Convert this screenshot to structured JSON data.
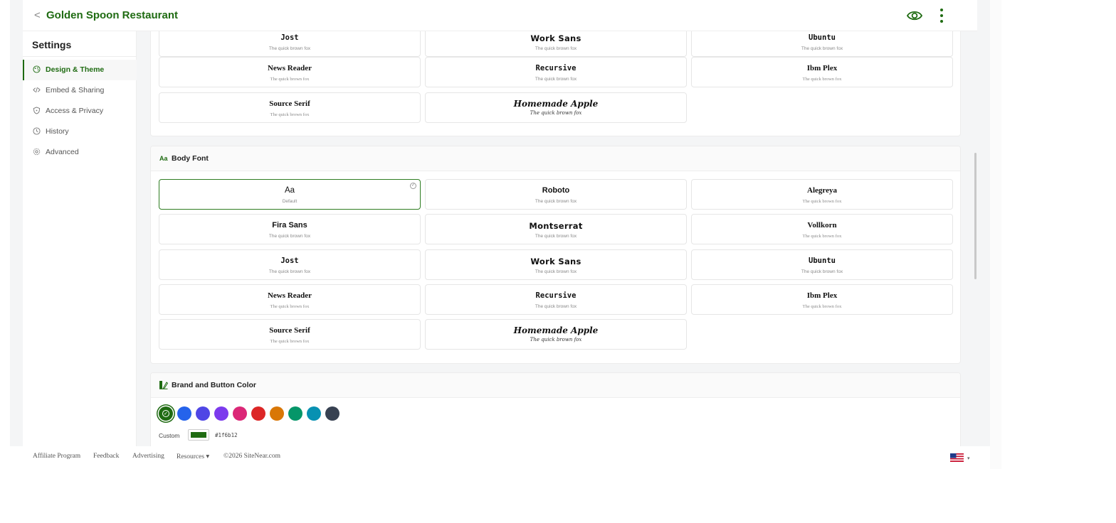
{
  "topbar": {
    "back_glyph": "<",
    "title": "Golden Spoon Restaurant",
    "accent_color": "#1f6b12"
  },
  "sidebar": {
    "heading": "Settings",
    "items": [
      {
        "label": "Design & Theme",
        "icon": "palette-icon",
        "active": true
      },
      {
        "label": "Embed & Sharing",
        "icon": "code-icon",
        "active": false
      },
      {
        "label": "Access & Privacy",
        "icon": "shield-icon",
        "active": false
      },
      {
        "label": "History",
        "icon": "clock-icon",
        "active": false
      },
      {
        "label": "Advanced",
        "icon": "gear-icon",
        "active": false
      }
    ]
  },
  "heading_fonts_partial": {
    "options": [
      {
        "name": "Jost",
        "sample": "The quick brown fox"
      },
      {
        "name": "Work Sans",
        "sample": "The quick brown fox"
      },
      {
        "name": "Ubuntu",
        "sample": "The quick brown fox"
      },
      {
        "name": "News Reader",
        "sample": "The quick brown fox"
      },
      {
        "name": "Recursive",
        "sample": "The quick brown fox"
      },
      {
        "name": "Ibm Plex",
        "sample": "The quick brown fox"
      },
      {
        "name": "Source Serif",
        "sample": "The quick brown fox"
      },
      {
        "name": "Homemade Apple",
        "sample": "The quick brown fox"
      }
    ]
  },
  "body_font": {
    "title_icon_text": "Aa",
    "title": "Body Font",
    "options": [
      {
        "name": "Aa",
        "sample": "Default",
        "selected": true
      },
      {
        "name": "Roboto",
        "sample": "The quick brown fox"
      },
      {
        "name": "Alegreya",
        "sample": "The quick brown fox"
      },
      {
        "name": "Fira Sans",
        "sample": "The quick brown fox"
      },
      {
        "name": "Montserrat",
        "sample": "The quick brown fox"
      },
      {
        "name": "Vollkorn",
        "sample": "The quick brown fox"
      },
      {
        "name": "Jost",
        "sample": "The quick brown fox"
      },
      {
        "name": "Work Sans",
        "sample": "The quick brown fox"
      },
      {
        "name": "Ubuntu",
        "sample": "The quick brown fox"
      },
      {
        "name": "News Reader",
        "sample": "The quick brown fox"
      },
      {
        "name": "Recursive",
        "sample": "The quick brown fox"
      },
      {
        "name": "Ibm Plex",
        "sample": "The quick brown fox"
      },
      {
        "name": "Source Serif",
        "sample": "The quick brown fox"
      },
      {
        "name": "Homemade Apple",
        "sample": "The quick brown fox"
      }
    ]
  },
  "brand_color": {
    "title": "Brand and Button Color",
    "swatches": [
      "#1f6b12",
      "#2563eb",
      "#4f46e5",
      "#7c3aed",
      "#db2777",
      "#dc2626",
      "#d97706",
      "#059669",
      "#0891b2",
      "#374151"
    ],
    "selected_index": 0,
    "custom_label": "Custom",
    "custom_value": "#1f6b12"
  },
  "footer": {
    "links": [
      "Affiliate Program",
      "Feedback",
      "Advertising",
      "Resources ▾",
      "©2026 SiteNear.com"
    ],
    "language_flag": "us-flag-icon"
  }
}
